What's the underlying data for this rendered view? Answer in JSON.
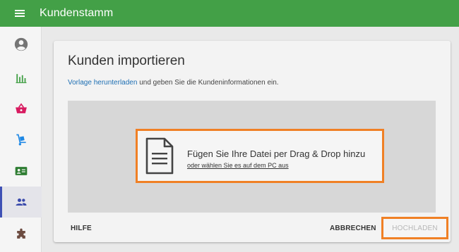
{
  "header": {
    "title": "Kundenstamm",
    "menu_icon": "menu-icon",
    "bg_color": "#43a047"
  },
  "sidebar": {
    "items": [
      {
        "name": "profile",
        "icon": "account-circle-icon",
        "color": "#757575"
      },
      {
        "name": "statistics",
        "icon": "bar-chart-icon",
        "color": "#43a047"
      },
      {
        "name": "shop",
        "icon": "basket-icon",
        "color": "#d81b60"
      },
      {
        "name": "delivery",
        "icon": "hand-truck-icon",
        "color": "#1e88e5"
      },
      {
        "name": "contacts",
        "icon": "contact-card-icon",
        "color": "#2e7d32"
      },
      {
        "name": "customers",
        "icon": "people-icon",
        "color": "#3949ab",
        "active": true
      },
      {
        "name": "extensions",
        "icon": "puzzle-icon",
        "color": "#6d4c41"
      }
    ]
  },
  "import": {
    "title": "Kunden importieren",
    "template_link": "Vorlage herunterladen",
    "description_rest": " und geben Sie die Kundeninformationen ein.",
    "dropzone": {
      "icon": "document-icon",
      "main_text": "Fügen Sie Ihre Datei per Drag & Drop hinzu",
      "sub_text": "oder wählen Sie es auf dem PC aus"
    },
    "help_label": "HILFE",
    "cancel_label": "ABBRECHEN",
    "upload_label": "HOCHLADEN"
  },
  "accent_color": "#f08025"
}
